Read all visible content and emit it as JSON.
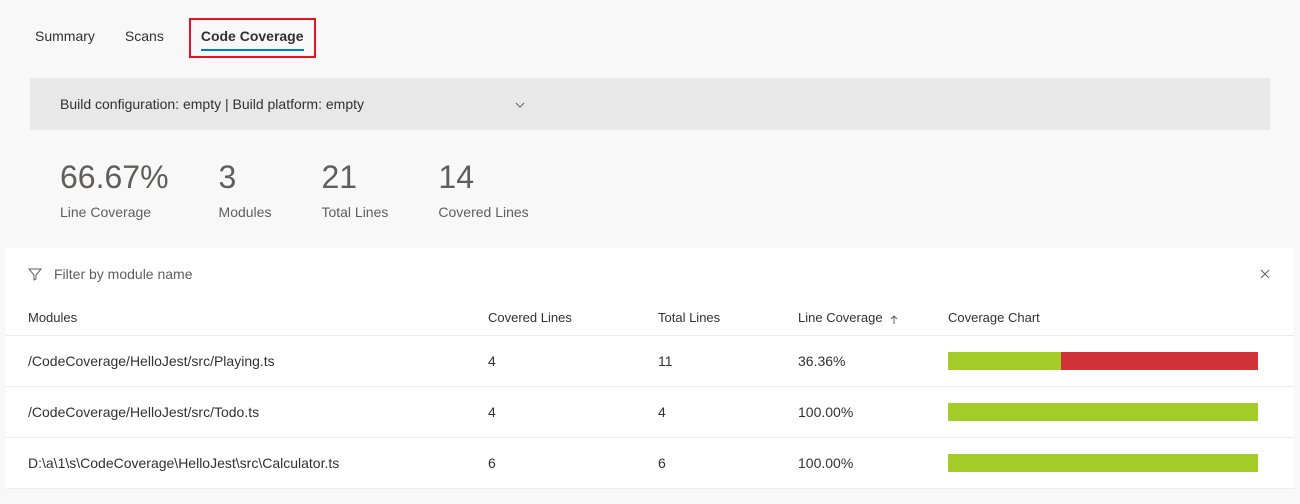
{
  "tabs": {
    "summary": "Summary",
    "scans": "Scans",
    "codeCoverage": "Code Coverage"
  },
  "configBar": {
    "text": "Build configuration: empty | Build platform: empty"
  },
  "metrics": {
    "lineCoverage": {
      "value": "66.67%",
      "label": "Line Coverage"
    },
    "modules": {
      "value": "3",
      "label": "Modules"
    },
    "totalLines": {
      "value": "21",
      "label": "Total Lines"
    },
    "coveredLines": {
      "value": "14",
      "label": "Covered Lines"
    }
  },
  "filter": {
    "placeholder": "Filter by module name"
  },
  "table": {
    "headers": {
      "modules": "Modules",
      "covered": "Covered Lines",
      "total": "Total Lines",
      "coverage": "Line Coverage",
      "chart": "Coverage Chart"
    },
    "rows": [
      {
        "module": "/CodeCoverage/HelloJest/src/Playing.ts",
        "covered": "4",
        "total": "11",
        "coverage": "36.36%",
        "coveragePercent": 36.36
      },
      {
        "module": "/CodeCoverage/HelloJest/src/Todo.ts",
        "covered": "4",
        "total": "4",
        "coverage": "100.00%",
        "coveragePercent": 100
      },
      {
        "module": "D:\\a\\1\\s\\CodeCoverage\\HelloJest\\src\\Calculator.ts",
        "covered": "6",
        "total": "6",
        "coverage": "100.00%",
        "coveragePercent": 100
      }
    ]
  }
}
